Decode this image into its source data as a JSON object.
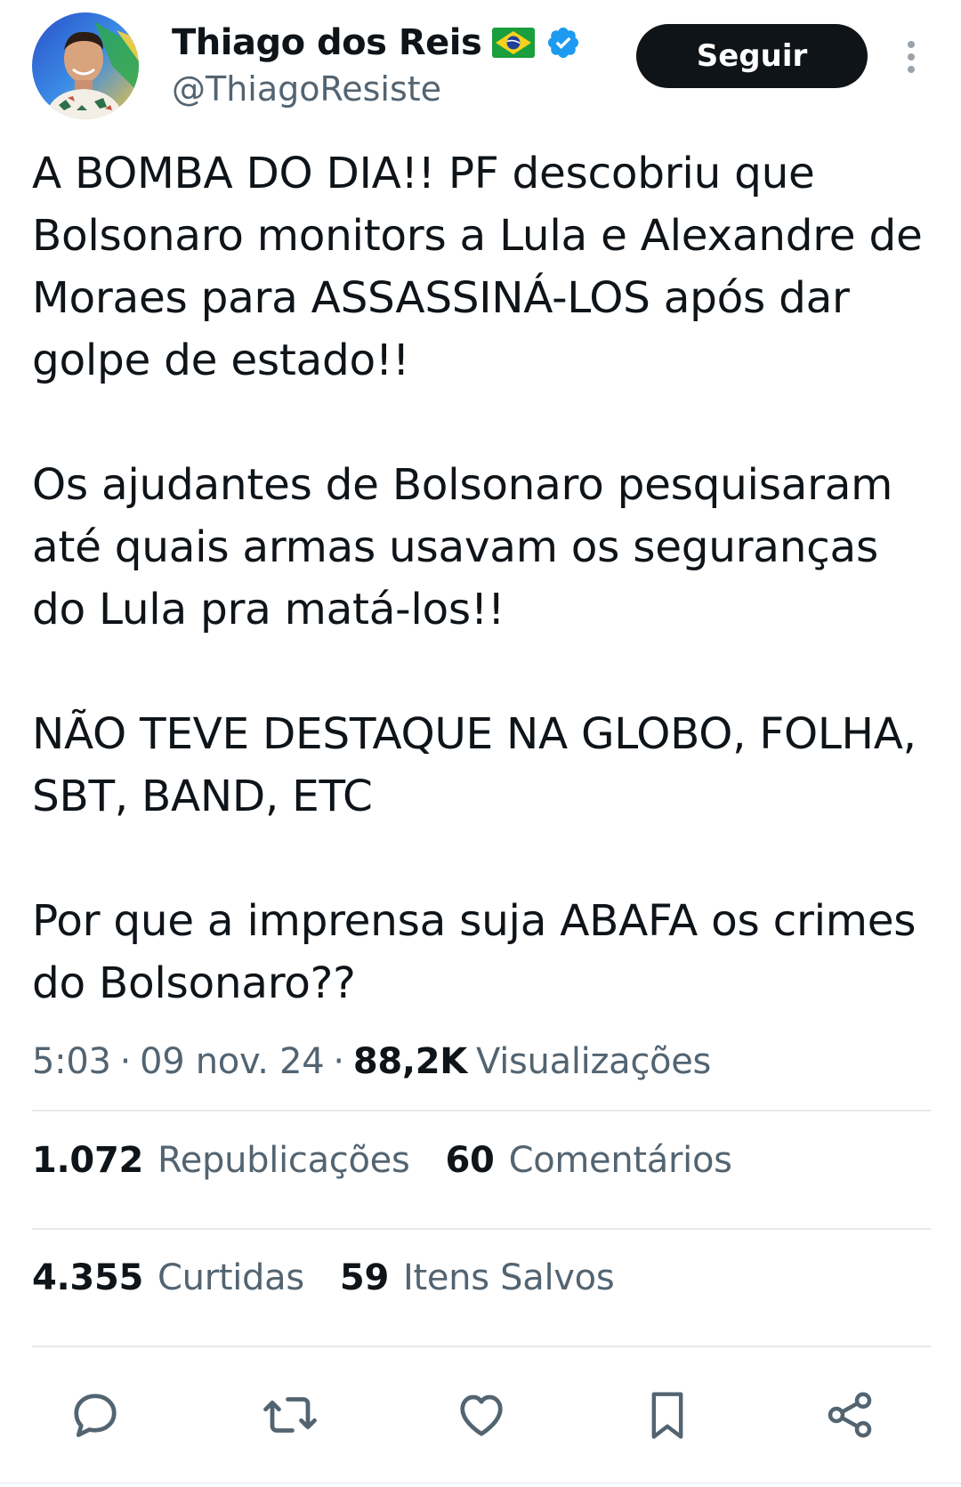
{
  "author": {
    "display_name": "Thiago dos Reis",
    "flag": "brazil-flag",
    "verified": true,
    "handle": "@ThiagoResiste"
  },
  "follow_button": {
    "label": "Seguir"
  },
  "tweet": {
    "paragraphs": [
      "A BOMBA DO DIA!! PF descobriu que Bolsonaro monitors a Lula e Alexandre de Moraes para ASSASSINÁ-LOS após dar golpe de estado!!",
      "Os ajudantes de Bolsonaro pesquisaram até quais armas usavam os seguranças do Lula pra matá-los!!",
      "NÃO TEVE DESTAQUE NA GLOBO, FOLHA, SBT, BAND, ETC",
      "Por que a imprensa suja ABAFA os crimes do Bolsonaro??"
    ]
  },
  "meta": {
    "time": "5:03",
    "separator": "·",
    "date": "09 nov. 24",
    "views_count": "88,2K",
    "views_label": "Visualizações"
  },
  "stats": {
    "reposts": {
      "count": "1.072",
      "label": "Republicações"
    },
    "comments": {
      "count": "60",
      "label": "Comentários"
    },
    "likes": {
      "count": "4.355",
      "label": "Curtidas"
    },
    "bookmarks": {
      "count": "59",
      "label": "Itens Salvos"
    }
  },
  "actions": [
    {
      "icon": "reply-icon"
    },
    {
      "icon": "repost-icon"
    },
    {
      "icon": "like-icon"
    },
    {
      "icon": "bookmark-icon"
    },
    {
      "icon": "share-icon"
    }
  ],
  "colors": {
    "text_primary": "#0f1419",
    "text_secondary": "#536471",
    "verified_blue": "#1d9bf0",
    "divider": "#e6e9ec",
    "button_bg": "#0f1419",
    "button_text": "#ffffff"
  }
}
